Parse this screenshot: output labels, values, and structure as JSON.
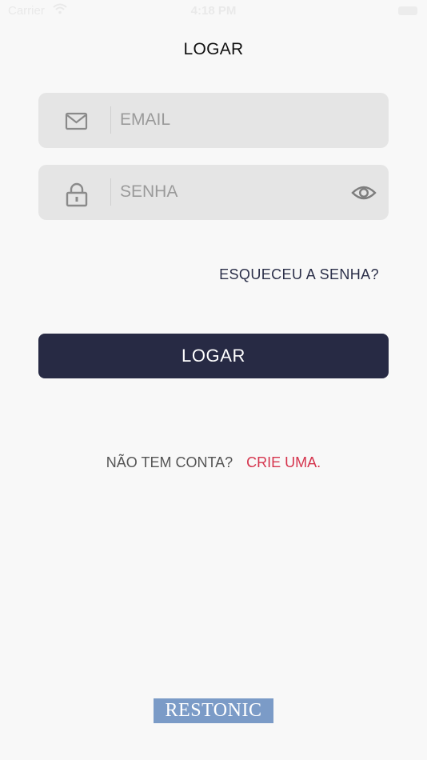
{
  "status_bar": {
    "carrier": "Carrier",
    "time": "4:18 PM"
  },
  "header": {
    "title": "LOGAR"
  },
  "form": {
    "email": {
      "placeholder": "EMAIL",
      "value": "",
      "icon": "mail-icon"
    },
    "password": {
      "placeholder": "SENHA",
      "value": "",
      "icon": "lock-icon",
      "toggle_icon": "eye-icon"
    },
    "forgot_label": "ESQUECEU A SENHA?",
    "submit_label": "LOGAR"
  },
  "signup": {
    "question": "NÃO TEM CONTA?",
    "link_label": "CRIE UMA."
  },
  "brand": {
    "logo_text": "RESTONIC"
  },
  "colors": {
    "background": "#f8f8f8",
    "field_background": "#e5e5e5",
    "primary_button": "#272a44",
    "link_accent": "#d5344d",
    "logo_background": "#7b9bc7"
  }
}
